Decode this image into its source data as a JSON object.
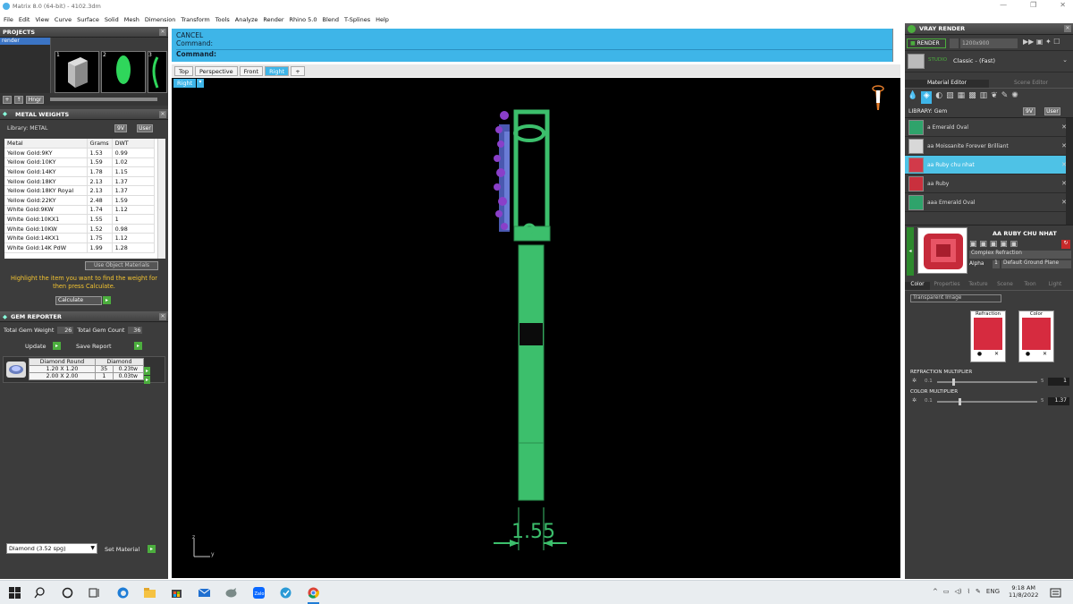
{
  "window": {
    "title": "Matrix 8.0 (64-bit) - 4102.3dm",
    "controls": [
      "—",
      "❐",
      "✕"
    ]
  },
  "menu": [
    "File",
    "Edit",
    "View",
    "Curve",
    "Surface",
    "Solid",
    "Mesh",
    "Dimension",
    "Transform",
    "Tools",
    "Analyze",
    "Render",
    "Rhino 5.0",
    "Blend",
    "T-Splines",
    "Help"
  ],
  "projects": {
    "header": "PROJECTS",
    "items": [
      "render"
    ],
    "thumbs": [
      "1",
      "2",
      "3"
    ],
    "hinge_label": "Hngr"
  },
  "metal_weights": {
    "header": "METAL WEIGHTS",
    "library_label": "Library: METAL",
    "library_btn_9v": "9V",
    "library_btn_user": "User",
    "columns": [
      "Metal",
      "Grams",
      "DWT"
    ],
    "rows": [
      [
        "Yellow Gold:9KY",
        "1.53",
        "0.99"
      ],
      [
        "Yellow Gold:10KY",
        "1.59",
        "1.02"
      ],
      [
        "Yellow Gold:14KY",
        "1.78",
        "1.15"
      ],
      [
        "Yellow Gold:18KY",
        "2.13",
        "1.37"
      ],
      [
        "Yellow Gold:18KY Royal",
        "2.13",
        "1.37"
      ],
      [
        "Yellow Gold:22KY",
        "2.48",
        "1.59"
      ],
      [
        "White Gold:9KW",
        "1.74",
        "1.12"
      ],
      [
        "White Gold:10KX1",
        "1.55",
        "1"
      ],
      [
        "White Gold:10KW",
        "1.52",
        "0.98"
      ],
      [
        "White Gold:14KX1",
        "1.75",
        "1.12"
      ],
      [
        "White Gold:14K PdW",
        "1.99",
        "1.28"
      ]
    ],
    "use_object_materials": "Use Object Materials",
    "instructions": "Highlight the item you want to find the weight for then press Calculate.",
    "calculate": "Calculate"
  },
  "gem_reporter": {
    "header": "GEM REPORTER",
    "total_weight_label": "Total Gem Weight",
    "total_weight": "26",
    "total_count_label": "Total Gem Count",
    "total_count": "36",
    "update": "Update",
    "save_report": "Save Report",
    "gem_table_headers": [
      "Diamond Round",
      "Diamond"
    ],
    "gem_rows": [
      [
        "1.20 X 1.20",
        "35",
        "0.23tw"
      ],
      [
        "2.00 X 2.00",
        "1",
        "0.03tw"
      ]
    ],
    "material_select": "Diamond   (3.52 spg)",
    "set_material": "Set Material"
  },
  "command": {
    "line1": "CANCEL",
    "line2": "Command:",
    "prompt": "Command:"
  },
  "viewport_tabs": [
    "Top",
    "Perspective",
    "Front",
    "Right",
    "+"
  ],
  "active_tab": "Right",
  "viewport": {
    "label": "Right",
    "dimension": "1.55",
    "axis_z": "z",
    "axis_y": "y"
  },
  "vray": {
    "header": "VRAY RENDER",
    "render_btn": "RENDER",
    "resolution": "1200x900",
    "mode_tag": "STUDIO",
    "preset": "Classic - (Fast)",
    "tab_material_editor": "Material Editor",
    "tab_scene_editor": "Scene Editor",
    "library_label": "LIBRARY: Gem",
    "lib_9v": "9V",
    "lib_user": "User",
    "materials": [
      {
        "name": "a Emerald Oval",
        "color": "#2fa36b"
      },
      {
        "name": "aa Moissanite Forever Brilliant",
        "color": "#d8d8d8"
      },
      {
        "name": "aa Ruby chu nhat",
        "color": "#d23a4a"
      },
      {
        "name": "aa Ruby",
        "color": "#c9303d"
      },
      {
        "name": "aaa Emerald Oval",
        "color": "#2fa36b"
      }
    ],
    "selected_material": "AA RUBY CHU NHAT",
    "complex_refraction": "Complex Refraction",
    "alpha_label": "Alpha",
    "alpha_val": "1",
    "ground_plane": "Default Ground Plane",
    "prop_tabs": [
      "Color",
      "Properties",
      "Texture",
      "Scene",
      "Toon",
      "Light"
    ],
    "transparent_image": "Transparent Image",
    "swatch_refraction": "Refraction",
    "swatch_color": "Color",
    "refraction_multiplier_label": "REFRACTION MULTIPLIER",
    "refraction_min": "0.1",
    "refraction_max": "5",
    "refraction_value": "1",
    "color_multiplier_label": "COLOR MULTIPLIER",
    "color_min": "0.1",
    "color_max": "5",
    "color_value": "1.37"
  },
  "taskbar": {
    "lang": "ENG",
    "time": "9:18 AM",
    "date": "11/8/2022",
    "icons": [
      "windows-icon",
      "search-icon",
      "task-view-circle-icon",
      "task-view-icon",
      "edge-icon",
      "file-explorer-icon",
      "store-icon",
      "mail-icon",
      "rhino-icon",
      "zalo-icon",
      "app-icon",
      "chrome-icon"
    ]
  },
  "colors": {
    "accent": "#3eb5e8",
    "green": "#4cae3e",
    "model_green": "#3cbf6c",
    "panel": "#3c3c3c"
  }
}
